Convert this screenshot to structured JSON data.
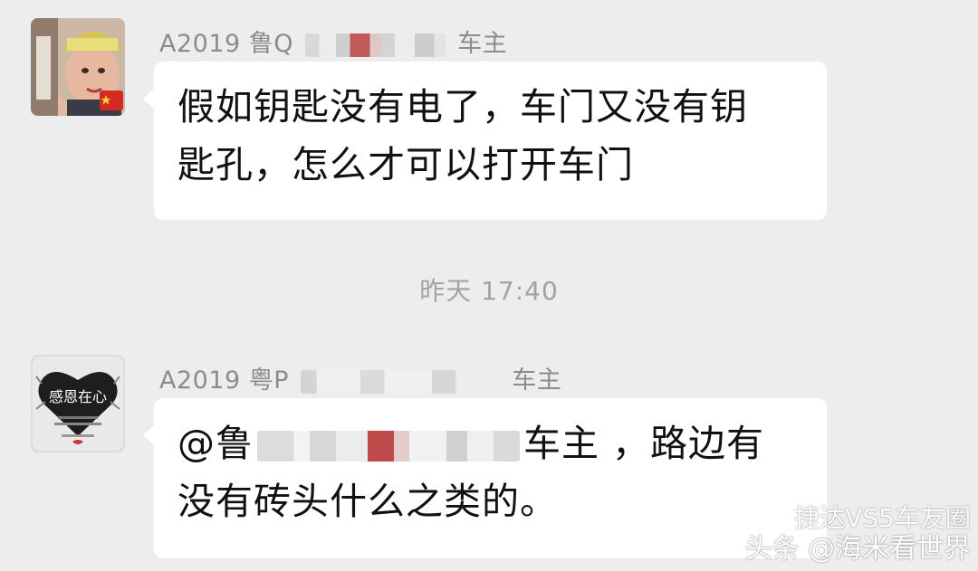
{
  "messages": [
    {
      "sender_prefix": "A2019 鲁Q",
      "sender_suffix": "车主",
      "lines": [
        "假如钥匙没有电了，车门又没有钥",
        "匙孔，怎么才可以打开车门"
      ]
    },
    {
      "sender_prefix": "A2019 粤P",
      "sender_suffix": "车主",
      "mention_prefix": "@鲁",
      "mention_suffix": "车主 ，路边有",
      "line2": "没有砖头什么之类的。"
    }
  ],
  "timestamp": "昨天 17:40",
  "watermark": {
    "line1": "捷达VS5车友圈",
    "line2": "头条 @海米看世界"
  },
  "avatar_text": {
    "avatar2_title": "感恩在心"
  },
  "colors": {
    "background": "#ededed",
    "bubble": "#ffffff",
    "name": "#8c8c8c",
    "timestamp": "#a3a3a3"
  }
}
